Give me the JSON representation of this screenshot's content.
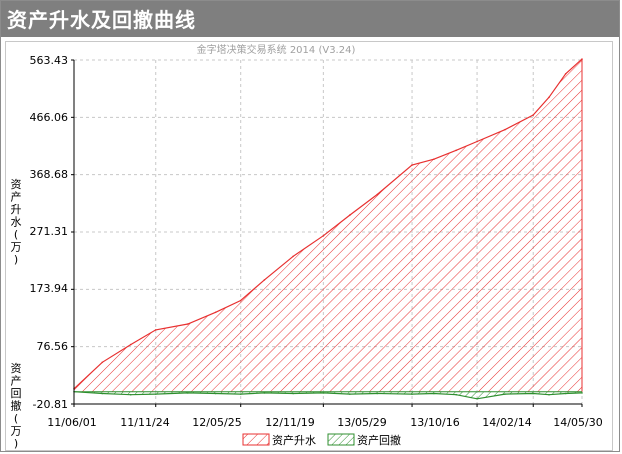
{
  "page": {
    "title": "资产升水及回撤曲线"
  },
  "chart_data": {
    "type": "area",
    "title": "金字塔决策交易系统 2014 (V3.24)",
    "ylabel_top": "资产升水(万)",
    "ylabel_bottom": "资产回撤(万)",
    "ylim": [
      -20.81,
      563.43
    ],
    "y_ticks": [
      "563.43",
      "466.06",
      "368.68",
      "271.31",
      "173.94",
      "76.56",
      "-20.81"
    ],
    "x_ticks": [
      "11/06/01",
      "11/11/24",
      "12/05/25",
      "12/11/19",
      "13/05/29",
      "13/10/16",
      "14/02/14",
      "14/05/30"
    ],
    "grid": true,
    "legend_position": "bottom-center",
    "series": [
      {
        "name": "资产升水",
        "color": "#e83030",
        "x": [
          "11/06/01",
          "11/08/01",
          "11/10/01",
          "11/11/24",
          "12/02/01",
          "12/04/01",
          "12/05/25",
          "12/07/15",
          "12/09/15",
          "12/11/19",
          "13/01/15",
          "13/03/15",
          "13/05/29",
          "13/07/15",
          "13/09/01",
          "13/10/16",
          "13/12/15",
          "14/02/14",
          "14/03/20",
          "14/04/25",
          "14/05/30"
        ],
        "values": [
          5,
          50,
          80,
          105,
          115,
          135,
          155,
          190,
          230,
          265,
          300,
          335,
          385,
          395,
          410,
          425,
          445,
          470,
          500,
          540,
          565
        ]
      },
      {
        "name": "资产回撤",
        "color": "#2f8f2f",
        "x": [
          "11/06/01",
          "11/08/01",
          "11/10/01",
          "11/11/24",
          "12/02/01",
          "12/04/01",
          "12/05/25",
          "12/07/15",
          "12/09/15",
          "12/11/19",
          "13/01/15",
          "13/03/15",
          "13/05/29",
          "13/07/15",
          "13/09/01",
          "13/10/16",
          "13/12/15",
          "14/02/14",
          "14/03/20",
          "14/04/25",
          "14/05/30"
        ],
        "values": [
          0,
          -3,
          -5,
          -4,
          -2,
          -3,
          -4,
          -2,
          -3,
          -2,
          -4,
          -3,
          -4,
          -3,
          -5,
          -12,
          -4,
          -3,
          -5,
          -3,
          -2
        ]
      }
    ]
  }
}
